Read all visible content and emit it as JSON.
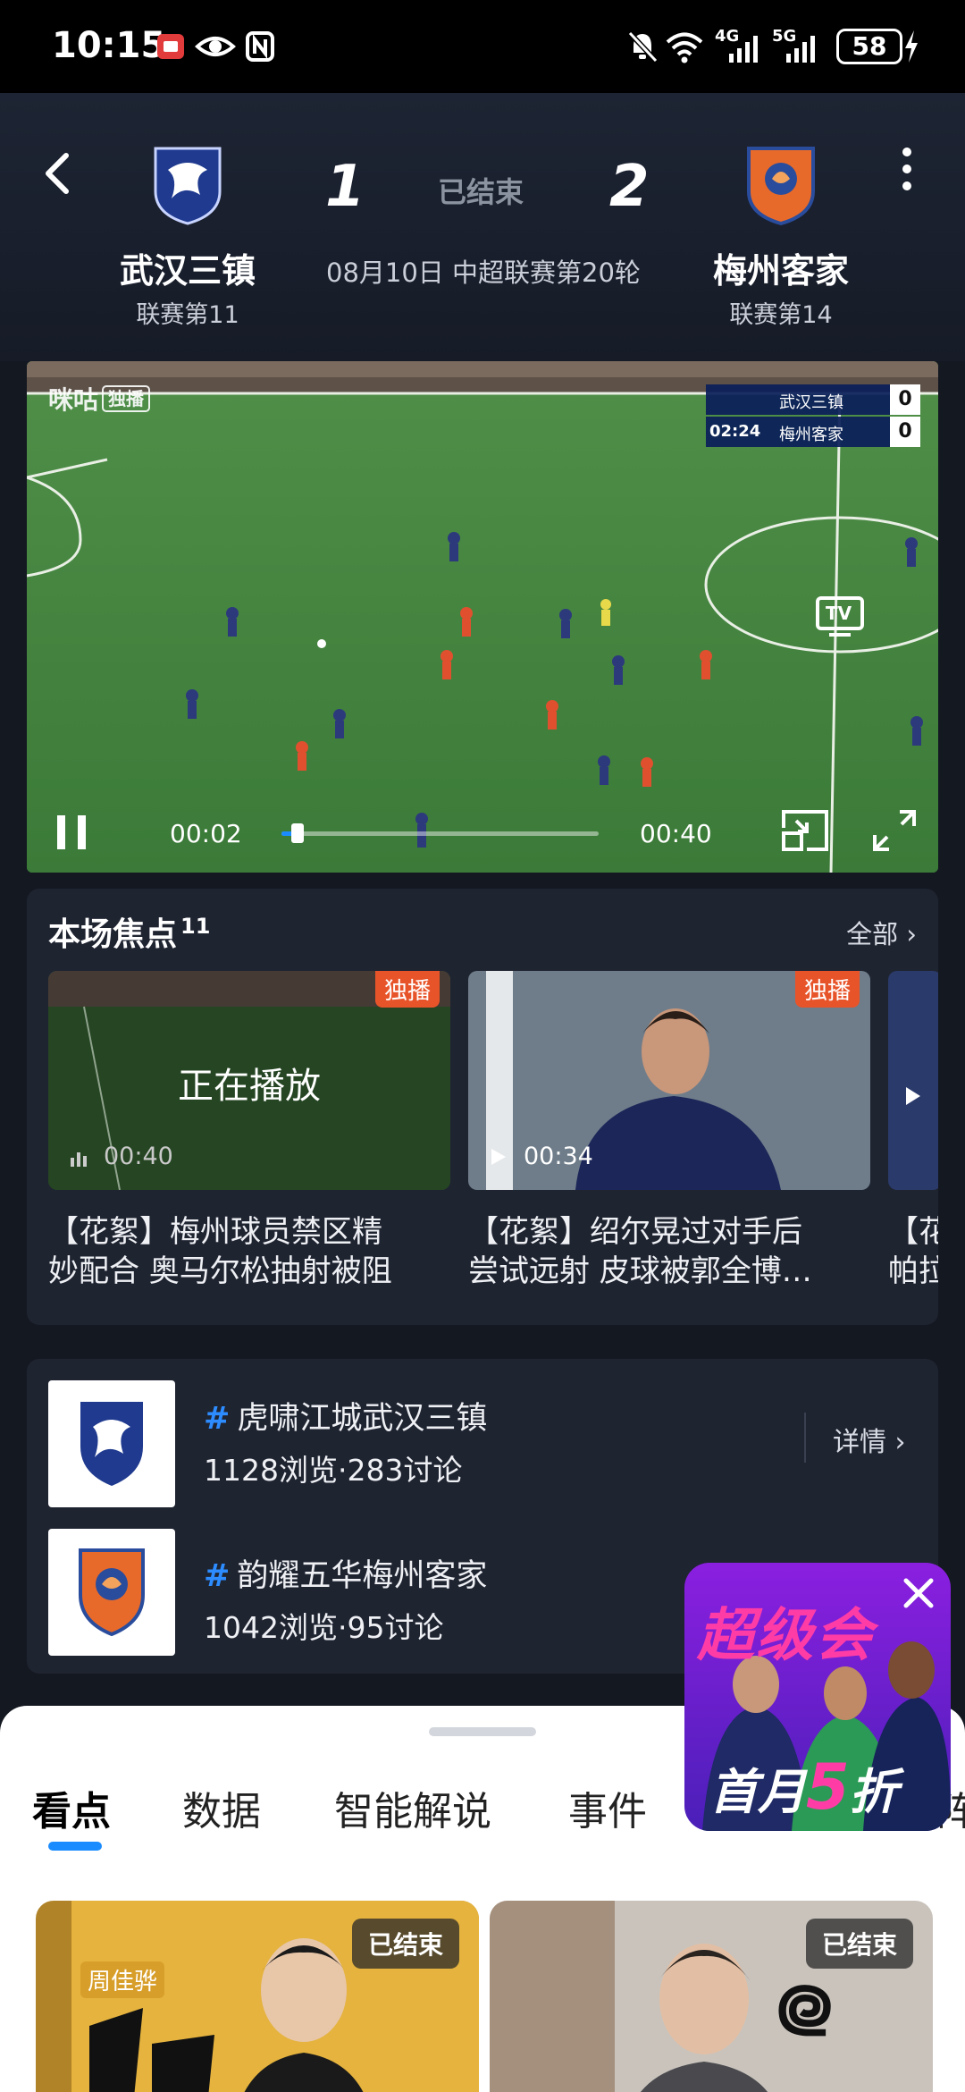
{
  "status_bar": {
    "time": "10:15",
    "network_4g": "4G",
    "network_5g": "5G",
    "battery": "58"
  },
  "match": {
    "home": {
      "name": "武汉三镇",
      "rank": "联赛第11",
      "score": "1"
    },
    "away": {
      "name": "梅州客家",
      "rank": "联赛第14",
      "score": "2"
    },
    "state": "已结束",
    "info": "08月10日 中超联赛第20轮"
  },
  "player": {
    "watermark": "咪咕",
    "watermark_tag": "独播",
    "scorebug": {
      "home_name": "武汉三镇",
      "home_score": "0",
      "away_name": "梅州客家",
      "away_score": "0",
      "clock": "02:24"
    },
    "tv_label": "TV",
    "current_time": "00:02",
    "duration": "00:40",
    "progress": 0.05
  },
  "highlights": {
    "title": "本场焦点",
    "count": "11",
    "all_label": "全部",
    "items": [
      {
        "badge": "独播",
        "duration": "00:40",
        "playing_label": "正在播放",
        "title_line1": "【花絮】梅州球员禁区精",
        "title_line2": "妙配合 奥马尔松抽射被阻"
      },
      {
        "badge": "独播",
        "duration": "00:34",
        "title_line1": "【花絮】绍尔晃过对手后",
        "title_line2": "尝试远射 皮球被郭全博…"
      },
      {
        "title_line1": "【花",
        "title_line2": "帕拉"
      }
    ]
  },
  "topics": {
    "detail_label": "详情",
    "items": [
      {
        "name": "虎啸江城武汉三镇",
        "stats": "1128浏览·283讨论"
      },
      {
        "name": "韵耀五华梅州客家",
        "stats": "1042浏览·95讨论"
      }
    ]
  },
  "tabs": {
    "items": [
      "看点",
      "数据",
      "智能解说",
      "事件",
      "阵"
    ],
    "active": 0
  },
  "content_cards": [
    {
      "status": "已结束",
      "name": "周佳骅"
    },
    {
      "status": "已结束"
    }
  ],
  "ad": {
    "line1": "超级会",
    "line2_a": "首月",
    "line2_b": "5",
    "line2_c": "折"
  },
  "colors": {
    "accent": "#1b8cff",
    "badge": "#e8542a",
    "hash": "#2d8cff"
  }
}
